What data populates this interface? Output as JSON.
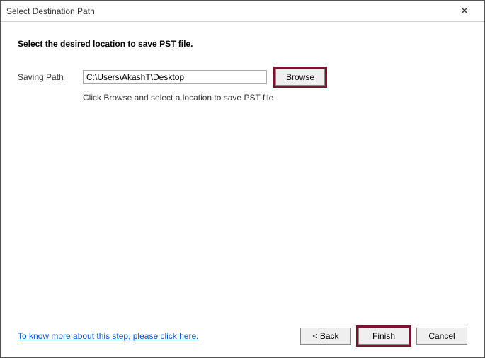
{
  "titlebar": {
    "title": "Select Destination Path",
    "close_glyph": "✕"
  },
  "content": {
    "instruction": "Select the desired location to save PST file.",
    "path_label": "Saving Path",
    "path_value": "C:\\Users\\AkashT\\Desktop",
    "browse_label": "Browse",
    "hint": "Click Browse and select a location to save PST file"
  },
  "footer": {
    "help_link": "To know more about this step, please click here.",
    "back_label": "< Back",
    "finish_label": "Finish",
    "cancel_label": "Cancel"
  }
}
